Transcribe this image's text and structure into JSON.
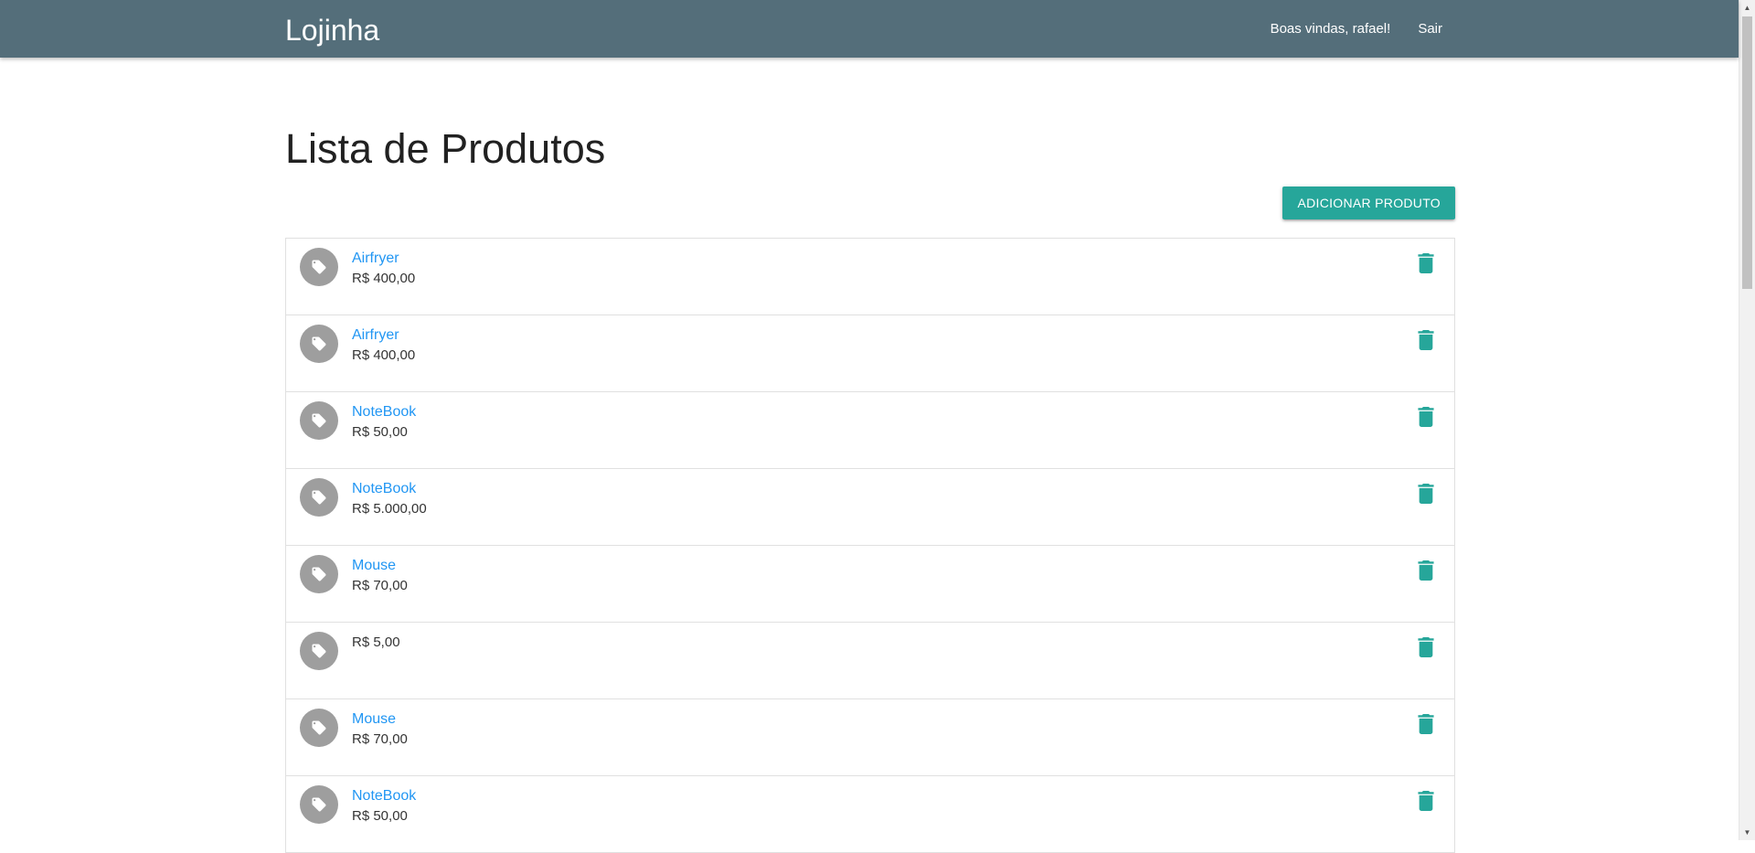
{
  "navbar": {
    "brand": "Lojinha",
    "welcome": "Boas vindas, rafael!",
    "logout": "Sair",
    "bg_color": "#546e7a"
  },
  "main": {
    "title": "Lista de Produtos",
    "add_button": "Adicionar produto",
    "accent_color": "#26a69a",
    "link_color": "#2196f3"
  },
  "products": [
    {
      "name": "Airfryer",
      "price": "R$ 400,00",
      "icon": "tag-icon",
      "action_icon": "trash-icon"
    },
    {
      "name": "Airfryer",
      "price": "R$ 400,00",
      "icon": "tag-icon",
      "action_icon": "trash-icon"
    },
    {
      "name": "NoteBook",
      "price": "R$ 50,00",
      "icon": "tag-icon",
      "action_icon": "trash-icon"
    },
    {
      "name": "NoteBook",
      "price": "R$ 5.000,00",
      "icon": "tag-icon",
      "action_icon": "trash-icon"
    },
    {
      "name": "Mouse",
      "price": "R$ 70,00",
      "icon": "tag-icon",
      "action_icon": "trash-icon"
    },
    {
      "name": "",
      "price": "R$ 5,00",
      "icon": "tag-icon",
      "action_icon": "trash-icon"
    },
    {
      "name": "Mouse",
      "price": "R$ 70,00",
      "icon": "tag-icon",
      "action_icon": "trash-icon"
    },
    {
      "name": "NoteBook",
      "price": "R$ 50,00",
      "icon": "tag-icon",
      "action_icon": "trash-icon"
    }
  ]
}
